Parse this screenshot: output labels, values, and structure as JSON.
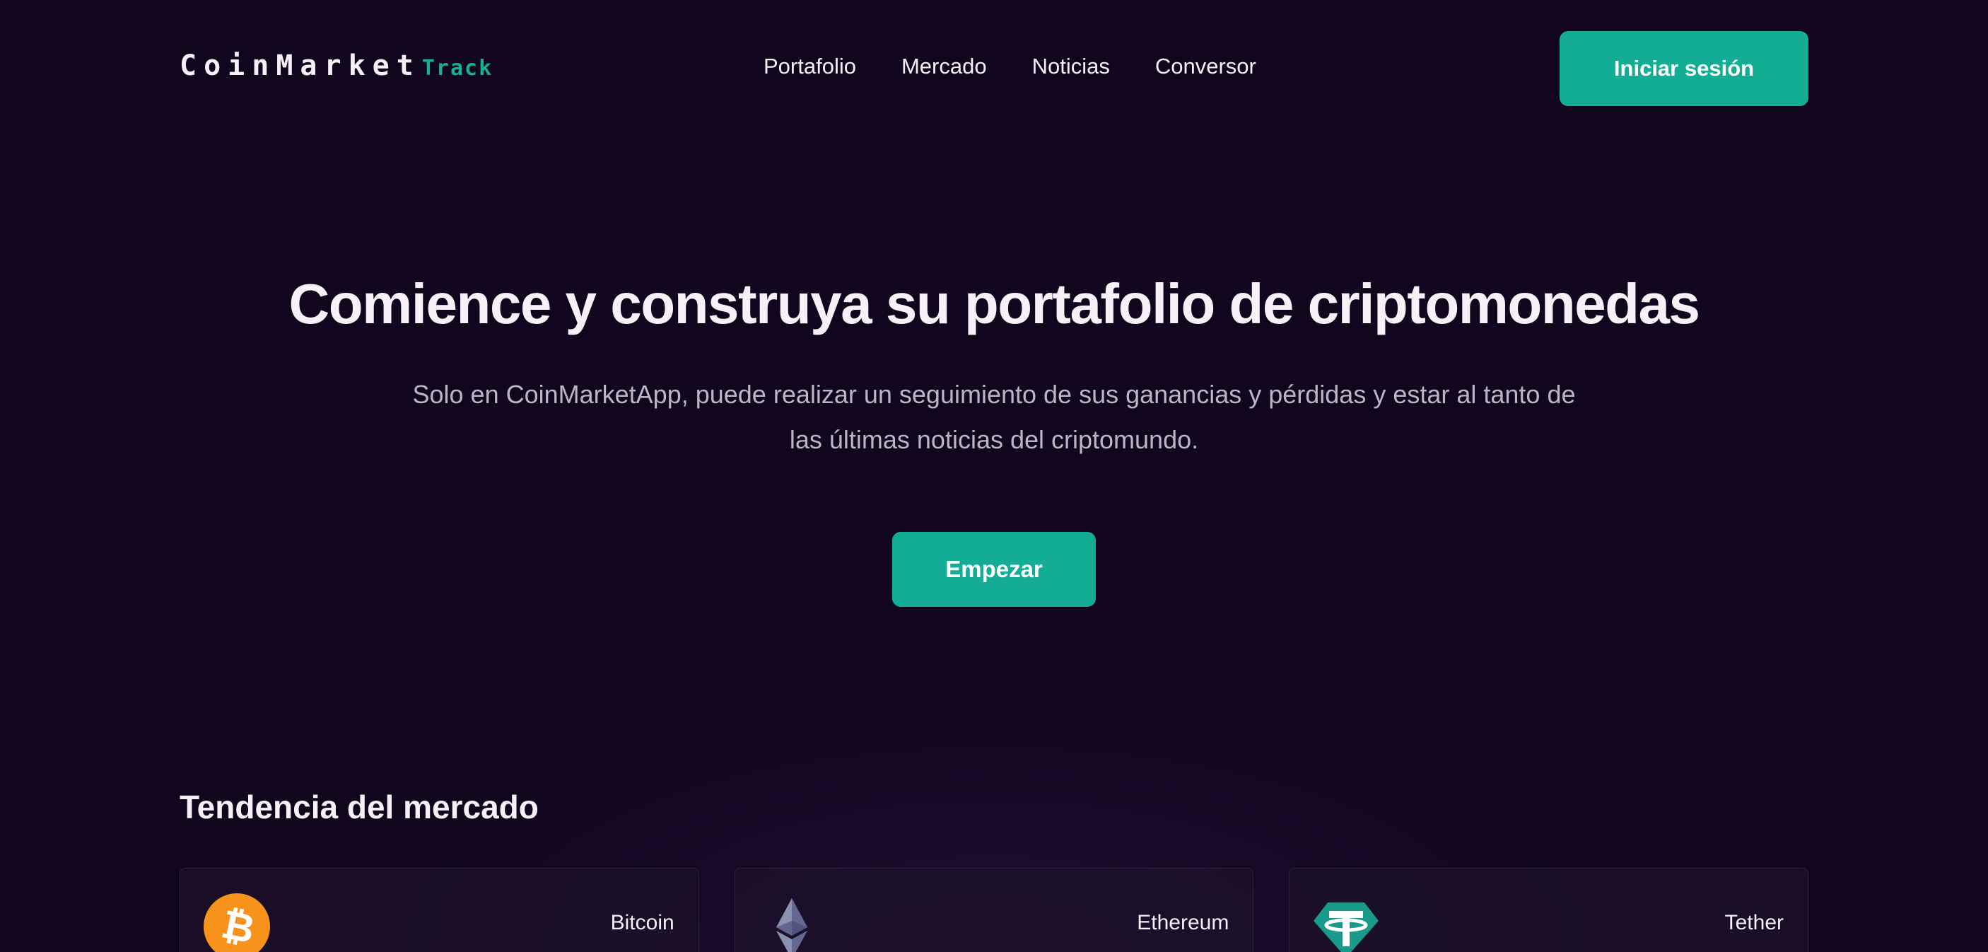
{
  "brand": {
    "name_main": "CoinMarket",
    "name_accent": "Track",
    "accent_color": "#14b196"
  },
  "nav": {
    "items": [
      {
        "label": "Portafolio"
      },
      {
        "label": "Mercado"
      },
      {
        "label": "Noticias"
      },
      {
        "label": "Conversor"
      }
    ],
    "login_label": "Iniciar sesión"
  },
  "hero": {
    "title": "Comience y construya su portafolio de criptomonedas",
    "subtitle": "Solo en CoinMarketApp, puede realizar un seguimiento de sus ganancias y pérdidas y estar al tanto de las últimas noticias del criptomundo.",
    "cta_label": "Empezar"
  },
  "trending": {
    "title": "Tendencia del mercado",
    "coins": [
      {
        "name": "Bitcoin",
        "icon": "bitcoin-icon",
        "color": "#f7931a"
      },
      {
        "name": "Ethereum",
        "icon": "ethereum-icon",
        "color": "#8a92b2"
      },
      {
        "name": "Tether",
        "icon": "tether-icon",
        "color": "#1a9a8a"
      }
    ]
  },
  "colors": {
    "background": "#12051e",
    "button": "#12ad94",
    "text": "#f4f2f7",
    "muted_text": "#bcb6c4"
  }
}
